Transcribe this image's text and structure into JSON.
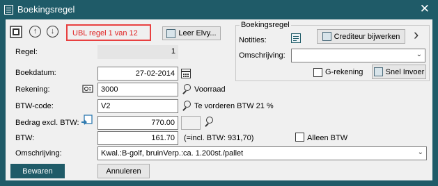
{
  "window": {
    "title": "Boekingsregel",
    "close_symbol": "✕"
  },
  "toolbar": {
    "ubl_status": "UBL regel 1 van 12",
    "leer_elvy_label": "Leer Elvy...",
    "up_symbol": "↑",
    "down_symbol": "↓"
  },
  "boekingsregel_group": {
    "title": "Boekingsregel",
    "notities_label": "Notities:",
    "crediteur_button_label": "Crediteur bijwerken",
    "next_symbol": "›",
    "omschrijving_label": "Omschrijving:",
    "omschrijving_value": "",
    "g_rekening_label": "G-rekening",
    "snel_invoer_label": "Snel Invoer"
  },
  "form": {
    "regel_label": "Regel:",
    "regel_value": "1",
    "boekdatum_label": "Boekdatum:",
    "boekdatum_value": "27-02-2014",
    "rekening_label": "Rekening:",
    "rekening_value": "3000",
    "rekening_name": "Voorraad",
    "btw_code_label": "BTW-code:",
    "btw_code_value": "V2",
    "btw_code_name": "Te vorderen BTW 21 %",
    "bedrag_label": "Bedrag excl. BTW:",
    "bedrag_value": "770.00",
    "bedrag_extra_value": "",
    "btw_label": "BTW:",
    "btw_value": "161.70",
    "btw_incl_text": "(=incl. BTW: 931,70)",
    "alleen_btw_label": "Alleen BTW",
    "omschrijving_label": "Omschrijving:",
    "omschrijving_value": "Kwal.:B-golf, bruinVerp.:ca. 1.200st./pallet"
  },
  "footer": {
    "bewaren_label": "Bewaren",
    "annuleren_label": "Annuleren"
  },
  "colors": {
    "title_bar": "#1f5b68",
    "ubl_highlight": "#e84040",
    "primary_button": "#1f5b68"
  },
  "icons": [
    "app-icon",
    "close-icon",
    "grid-icon",
    "arrow-up-icon",
    "arrow-down-icon",
    "elvy-icon",
    "notes-icon",
    "crediteur-icon",
    "chevron-right-icon",
    "chevron-down-icon",
    "calendar-icon",
    "account-icon",
    "search-icon",
    "calculator-icon",
    "snel-invoer-icon"
  ]
}
